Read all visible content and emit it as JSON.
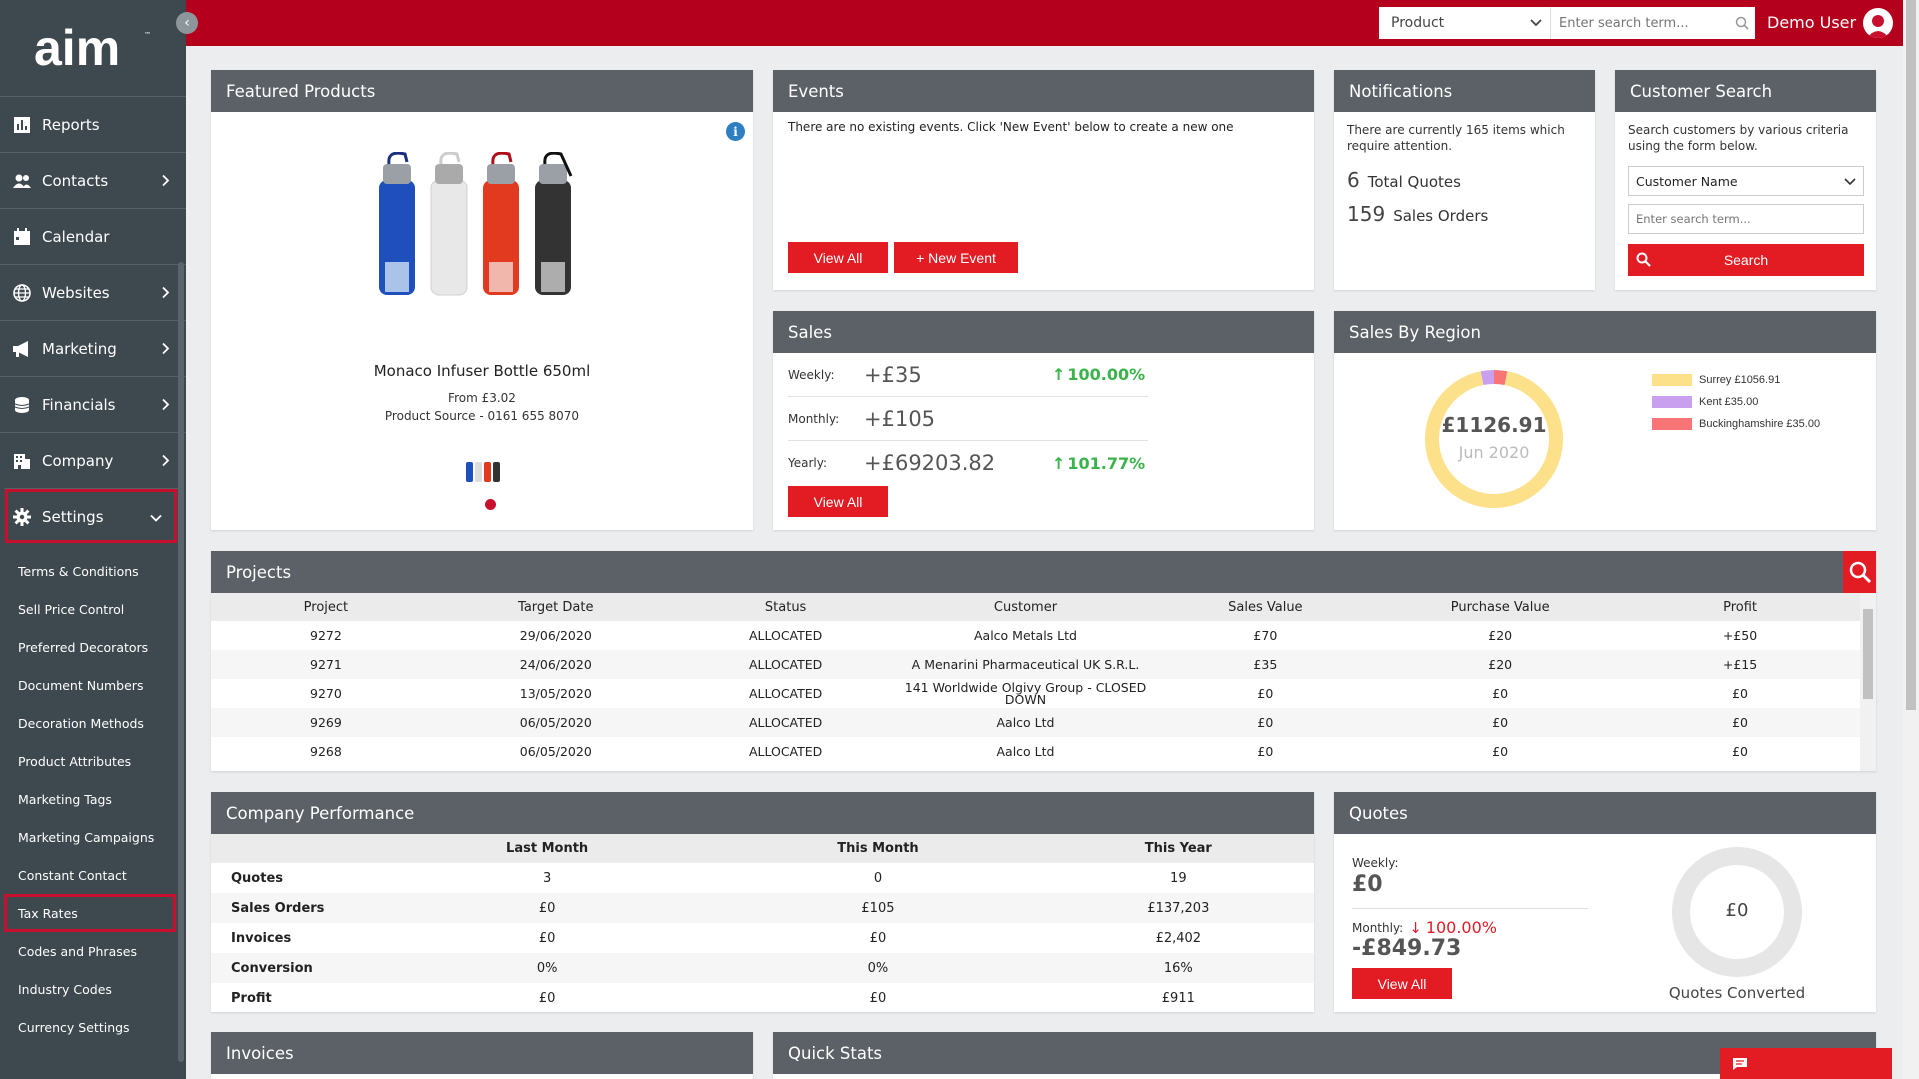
{
  "app": {
    "logo_text": "aim"
  },
  "sidebar": {
    "items": [
      {
        "label": "Reports",
        "icon": "bar-chart-icon",
        "has_children": false
      },
      {
        "label": "Contacts",
        "icon": "users-icon",
        "has_children": true
      },
      {
        "label": "Calendar",
        "icon": "calendar-icon",
        "has_children": false
      },
      {
        "label": "Websites",
        "icon": "globe-icon",
        "has_children": true
      },
      {
        "label": "Marketing",
        "icon": "megaphone-icon",
        "has_children": true
      },
      {
        "label": "Financials",
        "icon": "coins-icon",
        "has_children": true
      },
      {
        "label": "Company",
        "icon": "building-icon",
        "has_children": true
      },
      {
        "label": "Settings",
        "icon": "gear-icon",
        "has_children": true,
        "expanded": true
      }
    ],
    "settings_submenu": [
      "Terms & Conditions",
      "Sell Price Control",
      "Preferred Decorators",
      "Document Numbers",
      "Decoration Methods",
      "Product Attributes",
      "Marketing Tags",
      "Marketing Campaigns",
      "Constant Contact",
      "Tax Rates",
      "Codes and Phrases",
      "Industry Codes",
      "Currency Settings"
    ],
    "highlighted_submenu": "Tax Rates"
  },
  "topbar": {
    "search_select": "Product",
    "search_placeholder": "Enter search term...",
    "user_name": "Demo User",
    "brand_color": "#b5001d"
  },
  "featured": {
    "title": "Featured Products",
    "product_name": "Monaco Infuser Bottle 650ml",
    "price": "From £3.02",
    "source": "Product Source - 0161 655 8070"
  },
  "events": {
    "title": "Events",
    "empty_text": "There are no existing events. Click 'New Event' below to create a new one",
    "view_all": "View All",
    "new_event": "+ New Event"
  },
  "notifications": {
    "title": "Notifications",
    "text": "There are currently 165 items which require attention.",
    "quotes_count": "6",
    "quotes_label": "Total Quotes",
    "orders_count": "159",
    "orders_label": "Sales Orders"
  },
  "customer_search": {
    "title": "Customer Search",
    "text": "Search customers by various criteria using the form below.",
    "select_value": "Customer Name",
    "placeholder": "Enter search term...",
    "button": "Search"
  },
  "sales": {
    "title": "Sales",
    "rows": [
      {
        "label": "Weekly:",
        "value": "+£35",
        "change": "100.00%"
      },
      {
        "label": "Monthly:",
        "value": "+£105",
        "change": ""
      },
      {
        "label": "Yearly:",
        "value": "+£69203.82",
        "change": "101.77%"
      }
    ],
    "view_all": "View All"
  },
  "sales_region": {
    "title": "Sales By Region",
    "total": "£1126.91",
    "period": "Jun 2020",
    "legend": [
      {
        "label": "Surrey £1056.91",
        "value": 1056.91,
        "color": "#fde08a"
      },
      {
        "label": "Kent £35.00",
        "value": 35.0,
        "color": "#c9a0f0"
      },
      {
        "label": "Buckinghamshire £35.00",
        "value": 35.0,
        "color": "#f77577"
      }
    ]
  },
  "projects": {
    "title": "Projects",
    "columns": [
      "Project",
      "Target Date",
      "Status",
      "Customer",
      "Sales Value",
      "Purchase Value",
      "Profit"
    ],
    "rows": [
      [
        "9272",
        "29/06/2020",
        "ALLOCATED",
        "Aalco Metals Ltd",
        "£70",
        "£20",
        "+£50"
      ],
      [
        "9271",
        "24/06/2020",
        "ALLOCATED",
        "A Menarini Pharmaceutical UK S.R.L.",
        "£35",
        "£20",
        "+£15"
      ],
      [
        "9270",
        "13/05/2020",
        "ALLOCATED",
        "141 Worldwide Olgivy Group - CLOSED DOWN",
        "£0",
        "£0",
        "£0"
      ],
      [
        "9269",
        "06/05/2020",
        "ALLOCATED",
        "Aalco Ltd",
        "£0",
        "£0",
        "£0"
      ],
      [
        "9268",
        "06/05/2020",
        "ALLOCATED",
        "Aalco Ltd",
        "£0",
        "£0",
        "£0"
      ]
    ]
  },
  "performance": {
    "title": "Company Performance",
    "columns": [
      "",
      "Last Month",
      "This Month",
      "This Year"
    ],
    "rows": [
      [
        "Quotes",
        "3",
        "0",
        "19"
      ],
      [
        "Sales Orders",
        "£0",
        "£105",
        "£137,203"
      ],
      [
        "Invoices",
        "£0",
        "£0",
        "£2,402"
      ],
      [
        "Conversion",
        "0%",
        "0%",
        "16%"
      ],
      [
        "Profit",
        "£0",
        "£0",
        "£911"
      ]
    ]
  },
  "quotes": {
    "title": "Quotes",
    "weekly_label": "Weekly:",
    "weekly_value": "£0",
    "monthly_label": "Monthly:",
    "monthly_change": "100.00%",
    "monthly_value": "-£849.73",
    "view_all": "View All",
    "donut_value": "£0",
    "donut_caption": "Quotes Converted"
  },
  "invoices": {
    "title": "Invoices"
  },
  "quick_stats": {
    "title": "Quick Stats"
  }
}
